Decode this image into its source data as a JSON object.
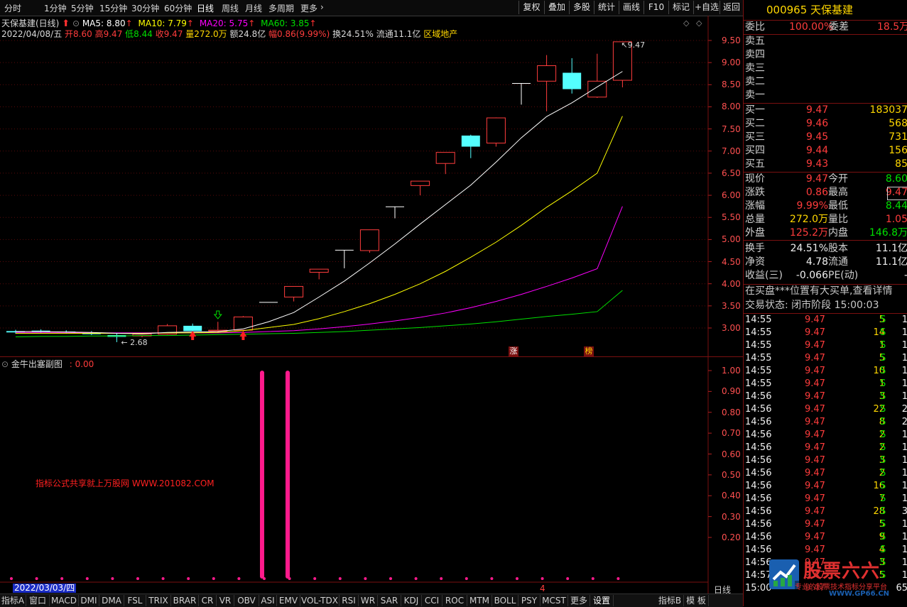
{
  "toolbar": {
    "periods": [
      "分时",
      "1分钟",
      "5分钟",
      "15分钟",
      "30分钟",
      "60分钟",
      "日线",
      "周线",
      "月线",
      "多周期",
      "更多"
    ],
    "active_period": "日线",
    "right_buttons": [
      "复权",
      "叠加",
      "多股",
      "统计",
      "画线",
      "F10",
      "标记",
      "+自选",
      "返回"
    ]
  },
  "info": {
    "title": "天保基建(日线)",
    "ma5": "MA5: 8.80",
    "ma10": "MA10: 7.79",
    "ma20": "MA20: 5.75",
    "ma60": "MA60: 3.85",
    "date": "2022/04/08/五",
    "open": "开8.60",
    "high": "高9.47",
    "low": "低8.44",
    "close": "收9.47",
    "volume": "量272.0万",
    "amount": "额24.8亿",
    "change": "幅0.86(9.99%)",
    "turnover": "换24.51%",
    "float": "流通11.1亿",
    "sector": "区域地产",
    "colors": {
      "ma5": "#ffffff",
      "ma10": "#ffff00",
      "ma20": "#ff00ff",
      "ma60": "#00e000",
      "up": "#ff3c3c",
      "flat": "#ffffff"
    }
  },
  "main_axis": [
    "9.50",
    "9.00",
    "8.50",
    "8.00",
    "7.50",
    "7.00",
    "6.50",
    "6.00",
    "5.50",
    "5.00",
    "4.50",
    "4.00",
    "3.50",
    "3.00"
  ],
  "chart_data": {
    "type": "candlestick",
    "price_range": [
      2.55,
      9.75
    ],
    "candles": [
      {
        "o": 2.9,
        "c": 2.93,
        "h": 2.96,
        "l": 2.87,
        "dir": "down"
      },
      {
        "o": 2.94,
        "c": 2.91,
        "h": 2.97,
        "l": 2.88,
        "dir": "down"
      },
      {
        "o": 2.92,
        "c": 2.9,
        "h": 2.95,
        "l": 2.87,
        "dir": "down"
      },
      {
        "o": 2.89,
        "c": 2.86,
        "h": 2.93,
        "l": 2.84,
        "dir": "down"
      },
      {
        "o": 2.84,
        "c": 2.8,
        "h": 2.89,
        "l": 2.68,
        "dir": "down"
      },
      {
        "o": 2.82,
        "c": 2.86,
        "h": 2.89,
        "l": 2.79,
        "dir": "up"
      },
      {
        "o": 2.86,
        "c": 3.05,
        "h": 3.09,
        "l": 2.85,
        "dir": "up"
      },
      {
        "o": 3.05,
        "c": 2.93,
        "h": 3.1,
        "l": 2.89,
        "dir": "down"
      },
      {
        "o": 2.93,
        "c": 2.95,
        "h": 3.14,
        "l": 2.9,
        "dir": "up"
      },
      {
        "o": 2.95,
        "c": 3.25,
        "h": 3.27,
        "l": 2.93,
        "dir": "up"
      },
      {
        "o": 3.58,
        "c": 3.58,
        "h": 3.58,
        "l": 3.58,
        "dir": "flat"
      },
      {
        "o": 3.7,
        "c": 3.94,
        "h": 3.94,
        "l": 3.6,
        "dir": "up"
      },
      {
        "o": 4.26,
        "c": 4.33,
        "h": 4.33,
        "l": 4.1,
        "dir": "up"
      },
      {
        "o": 4.76,
        "c": 4.76,
        "h": 4.76,
        "l": 4.35,
        "dir": "flat"
      },
      {
        "o": 4.75,
        "c": 5.22,
        "h": 5.22,
        "l": 4.7,
        "dir": "up"
      },
      {
        "o": 5.74,
        "c": 5.74,
        "h": 5.74,
        "l": 5.48,
        "dir": "flat"
      },
      {
        "o": 6.22,
        "c": 6.32,
        "h": 6.32,
        "l": 6.0,
        "dir": "up"
      },
      {
        "o": 6.72,
        "c": 6.97,
        "h": 6.97,
        "l": 6.48,
        "dir": "up"
      },
      {
        "o": 7.35,
        "c": 7.1,
        "h": 7.37,
        "l": 6.84,
        "dir": "down"
      },
      {
        "o": 7.18,
        "c": 7.75,
        "h": 7.76,
        "l": 7.1,
        "dir": "up"
      },
      {
        "o": 8.53,
        "c": 8.53,
        "h": 8.53,
        "l": 8.05,
        "dir": "flat"
      },
      {
        "o": 8.58,
        "c": 8.93,
        "h": 9.17,
        "l": 7.9,
        "dir": "up"
      },
      {
        "o": 8.77,
        "c": 8.4,
        "h": 9.1,
        "l": 8.3,
        "dir": "down"
      },
      {
        "o": 8.22,
        "c": 8.58,
        "h": 9.2,
        "l": 8.2,
        "dir": "up"
      },
      {
        "o": 8.6,
        "c": 9.47,
        "h": 9.47,
        "l": 8.44,
        "dir": "up"
      }
    ],
    "ma5": [
      2.92,
      2.92,
      2.91,
      2.9,
      2.88,
      2.87,
      2.9,
      2.91,
      2.92,
      2.98,
      3.14,
      3.35,
      3.7,
      4.06,
      4.47,
      4.9,
      5.35,
      5.79,
      6.23,
      6.75,
      7.3,
      7.78,
      8.09,
      8.45,
      8.8
    ],
    "ma10": [
      2.88,
      2.88,
      2.88,
      2.88,
      2.88,
      2.88,
      2.89,
      2.89,
      2.9,
      2.94,
      3.01,
      3.08,
      3.21,
      3.37,
      3.55,
      3.76,
      4.0,
      4.28,
      4.6,
      4.94,
      5.32,
      5.73,
      6.1,
      6.5,
      7.79
    ],
    "ma20": [
      2.9,
      2.9,
      2.9,
      2.89,
      2.89,
      2.89,
      2.89,
      2.89,
      2.89,
      2.9,
      2.92,
      2.94,
      2.98,
      3.03,
      3.09,
      3.16,
      3.24,
      3.34,
      3.46,
      3.6,
      3.76,
      3.94,
      4.13,
      4.34,
      5.75
    ],
    "ma60": [
      2.8,
      2.81,
      2.81,
      2.82,
      2.82,
      2.83,
      2.83,
      2.84,
      2.85,
      2.86,
      2.87,
      2.88,
      2.9,
      2.92,
      2.95,
      2.98,
      3.01,
      3.05,
      3.09,
      3.14,
      3.2,
      3.26,
      3.31,
      3.37,
      3.85
    ],
    "low_label": "2.68",
    "high_label": "9.47"
  },
  "markers": {
    "zhang": "涨",
    "bang": "榜"
  },
  "sub": {
    "title": "金牛出塞副图",
    "value": ": 0.00",
    "axis": [
      "1.00",
      "0.90",
      "0.80",
      "0.70",
      "0.60",
      "0.50",
      "0.40",
      "0.30",
      "0.20"
    ],
    "watermark": "指标公式共享就上万股网 WWW.201082.COM",
    "date_label": "2022/03/03/四",
    "cursor_label": "4"
  },
  "bottom_tabs": [
    "指标A",
    "窗口",
    "MACD",
    "DMI",
    "DMA",
    "FSL",
    "TRIX",
    "BRAR",
    "CR",
    "VR",
    "OBV",
    "ASI",
    "EMV",
    "VOL-TDX",
    "RSI",
    "WR",
    "SAR",
    "KDJ",
    "CCI",
    "ROC",
    "MTM",
    "BOLL",
    "PSY",
    "MCST",
    "更多",
    "设置",
    "指标B",
    "模 板"
  ],
  "period_label": "日线",
  "right_panel": {
    "code": "000965",
    "name": "天保基建",
    "weibi_label": "委比",
    "weibi": "100.00%",
    "weicha_label": "委差",
    "weicha": "18.5万",
    "sells": [
      "卖五",
      "卖四",
      "卖三",
      "卖二",
      "卖一"
    ],
    "buys": [
      {
        "label": "买一",
        "price": "9.47",
        "vol": "183037"
      },
      {
        "label": "买二",
        "price": "9.46",
        "vol": "568"
      },
      {
        "label": "买三",
        "price": "9.45",
        "vol": "731"
      },
      {
        "label": "买四",
        "price": "9.44",
        "vol": "156"
      },
      {
        "label": "买五",
        "price": "9.43",
        "vol": "85"
      }
    ],
    "stats": [
      {
        "l1": "现价",
        "v1": "9.47",
        "c1": "red",
        "l2": "今开",
        "v2": "8.60",
        "c2": "grn"
      },
      {
        "l1": "涨跌",
        "v1": "0.86",
        "c1": "red",
        "l2": "最高",
        "v2": "9.47",
        "c2": "red"
      },
      {
        "l1": "涨幅",
        "v1": "9.99%",
        "c1": "red",
        "l2": "最低",
        "v2": "8.44",
        "c2": "grn"
      },
      {
        "l1": "总量",
        "v1": "272.0万",
        "c1": "yel",
        "l2": "量比",
        "v2": "1.05",
        "c2": "red"
      },
      {
        "l1": "外盘",
        "v1": "125.2万",
        "c1": "red",
        "l2": "内盘",
        "v2": "146.8万",
        "c2": "grn"
      },
      {
        "l1": "换手",
        "v1": "24.51%",
        "c1": "wht",
        "l2": "股本",
        "v2": "11.1亿",
        "c2": "wht"
      },
      {
        "l1": "净资",
        "v1": "4.78",
        "c1": "wht",
        "l2": "流通",
        "v2": "11.1亿",
        "c2": "wht"
      },
      {
        "l1": "收益(三)",
        "v1": "-0.066",
        "c1": "wht",
        "l2": "PE(动)",
        "v2": "-",
        "c2": "wht"
      }
    ],
    "notice": "在买盘***位置有大买单,查看详情",
    "status": "交易状态: 闭市阶段 15:00:03",
    "ticks": [
      {
        "t": "14:55",
        "p": "9.47",
        "v": "5",
        "s": "S",
        "n": "1"
      },
      {
        "t": "14:55",
        "p": "9.47",
        "v": "14",
        "s": "S",
        "n": "1"
      },
      {
        "t": "14:55",
        "p": "9.47",
        "v": "1",
        "s": "S",
        "n": "1"
      },
      {
        "t": "14:55",
        "p": "9.47",
        "v": "5",
        "s": "S",
        "n": "1"
      },
      {
        "t": "14:55",
        "p": "9.47",
        "v": "10",
        "s": "S",
        "n": "1"
      },
      {
        "t": "14:55",
        "p": "9.47",
        "v": "1",
        "s": "S",
        "n": "1"
      },
      {
        "t": "14:56",
        "p": "9.47",
        "v": "3",
        "s": "S",
        "n": "1"
      },
      {
        "t": "14:56",
        "p": "9.47",
        "v": "22",
        "s": "S",
        "n": "2"
      },
      {
        "t": "14:56",
        "p": "9.47",
        "v": "8",
        "s": "S",
        "n": "2"
      },
      {
        "t": "14:56",
        "p": "9.47",
        "v": "2",
        "s": "S",
        "n": "1"
      },
      {
        "t": "14:56",
        "p": "9.47",
        "v": "2",
        "s": "S",
        "n": "1"
      },
      {
        "t": "14:56",
        "p": "9.47",
        "v": "3",
        "s": "S",
        "n": "1"
      },
      {
        "t": "14:56",
        "p": "9.47",
        "v": "2",
        "s": "S",
        "n": "1"
      },
      {
        "t": "14:56",
        "p": "9.47",
        "v": "16",
        "s": "S",
        "n": "1"
      },
      {
        "t": "14:56",
        "p": "9.47",
        "v": "7",
        "s": "S",
        "n": "1"
      },
      {
        "t": "14:56",
        "p": "9.47",
        "v": "28",
        "s": "S",
        "n": "3"
      },
      {
        "t": "14:56",
        "p": "9.47",
        "v": "5",
        "s": "S",
        "n": "1"
      },
      {
        "t": "14:56",
        "p": "9.47",
        "v": "9",
        "s": "S",
        "n": "1"
      },
      {
        "t": "14:56",
        "p": "9.47",
        "v": "4",
        "s": "S",
        "n": "1"
      },
      {
        "t": "14:56",
        "p": "9.47",
        "v": "3",
        "s": "S",
        "n": "1"
      },
      {
        "t": "14:57",
        "p": "9.47",
        "v": "5",
        "s": "S",
        "n": "1"
      },
      {
        "t": "15:00",
        "p": "9.47",
        "v": "",
        "s": "",
        "n": "65"
      }
    ],
    "logo_text": "股票六六",
    "logo_sub": "专业的股票技术指标分享平台",
    "logo_url": "WWW.GP66.CN"
  }
}
